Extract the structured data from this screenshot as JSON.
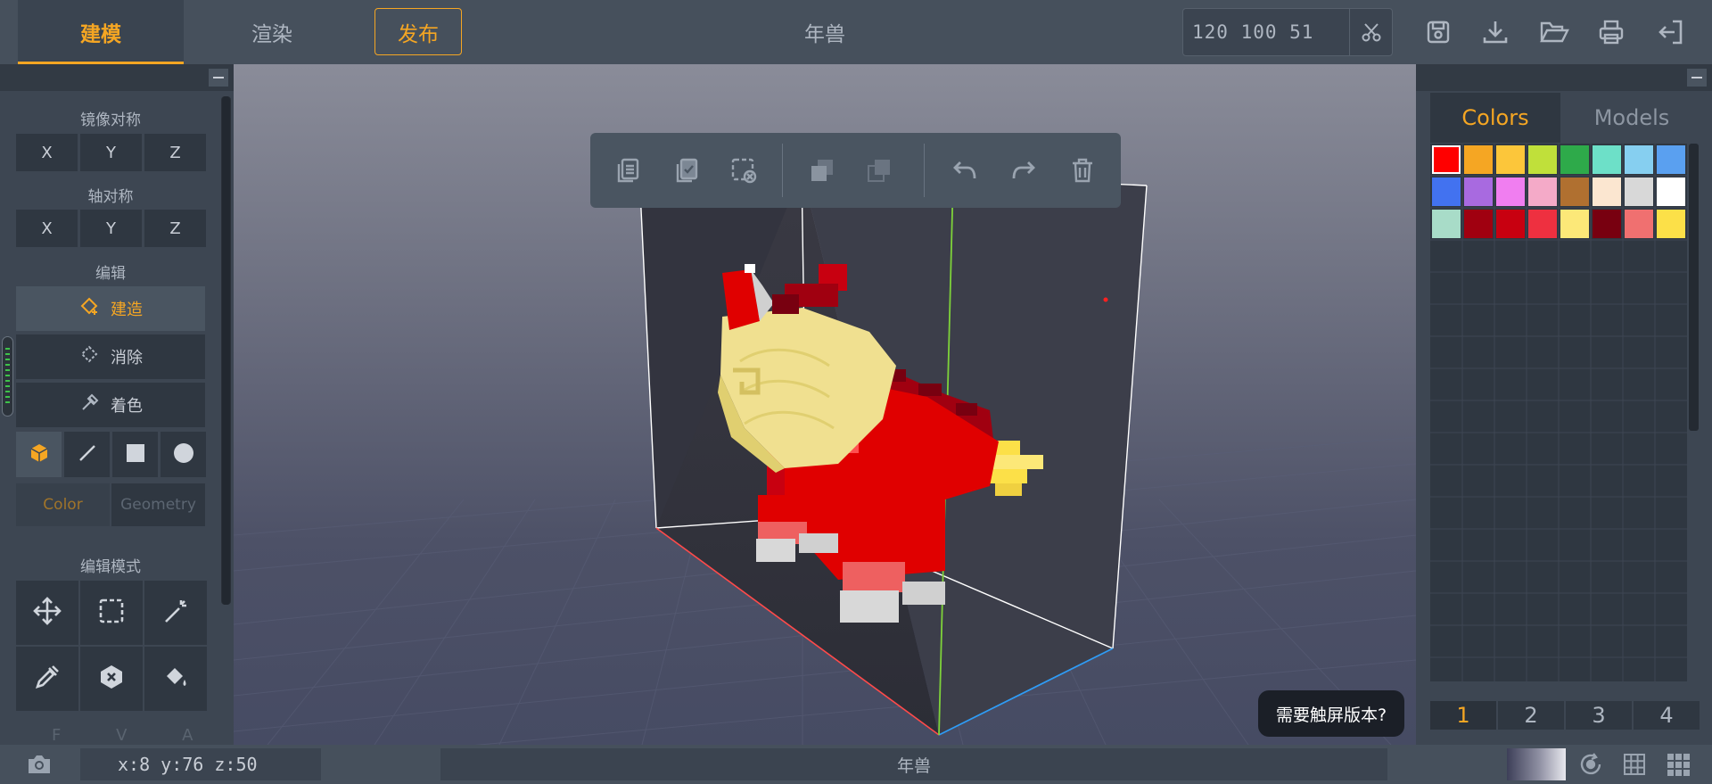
{
  "topbar": {
    "tabs": [
      {
        "label": "建模",
        "active": true
      },
      {
        "label": "渲染",
        "active": false
      }
    ],
    "publish_label": "发布",
    "doc_title": "年兽",
    "dimensions": "120 100 51",
    "icons": [
      "scissors-icon",
      "save-icon",
      "download-icon",
      "folder-open-icon",
      "print-icon",
      "exit-icon"
    ]
  },
  "left_panel": {
    "mirror_label": "镜像对称",
    "mirror_axes": [
      "X",
      "Y",
      "Z"
    ],
    "axis_label": "轴对称",
    "axis_axes": [
      "X",
      "Y",
      "Z"
    ],
    "edit_label": "编辑",
    "modes": [
      {
        "label": "建造",
        "icon": "build-icon",
        "active": true
      },
      {
        "label": "消除",
        "icon": "erase-icon",
        "active": false
      },
      {
        "label": "着色",
        "icon": "paint-icon",
        "active": false
      }
    ],
    "shapes": [
      "cube-icon",
      "line-icon",
      "square-icon",
      "circle-icon"
    ],
    "subtabs": [
      {
        "label": "Color",
        "active": true
      },
      {
        "label": "Geometry",
        "active": false
      }
    ],
    "edit_mode_label": "编辑模式",
    "tools": [
      "move-icon",
      "select-icon",
      "magic-wand-icon",
      "eyedropper-icon",
      "remove-icon",
      "bucket-fill-icon"
    ],
    "bottom_letters": "F V A"
  },
  "viewport": {
    "toolbar_icons": [
      "copy-icon",
      "paste-icon",
      "clear-selection-icon",
      "merge-icon",
      "subtract-icon",
      "undo-icon",
      "redo-icon",
      "delete-icon"
    ],
    "touch_tip": "需要触屏版本?"
  },
  "right_panel": {
    "tabs": [
      {
        "label": "Colors",
        "active": true
      },
      {
        "label": "Models",
        "active": false
      }
    ],
    "palette": [
      "#ff0000",
      "#f5a623",
      "#fcc63a",
      "#c0e03a",
      "#2eaa4a",
      "#6de0c8",
      "#86cff0",
      "#5aa0f0",
      "#4272f0",
      "#a86ae0",
      "#f07ef0",
      "#f4aac8",
      "#b07030",
      "#fbe6d0",
      "#d8d8d8",
      "#ffffff",
      "#a8dcc8",
      "#a00010",
      "#c80010",
      "#ee3040",
      "#fce878",
      "#780010",
      "#f07070",
      "#fce048"
    ],
    "selected_color": "#ff0000",
    "pages": [
      "1",
      "2",
      "3",
      "4"
    ],
    "active_page": "1"
  },
  "bottombar": {
    "coords": "x:8  y:76  z:50",
    "title": "年兽",
    "icons": [
      "camera-icon",
      "orbit-icon",
      "grid-icon",
      "palette-grid-icon"
    ]
  },
  "colors": {
    "accent": "#f5a623",
    "panel": "#3d4652",
    "button": "#2f3741",
    "axis_x": "#ff4040",
    "axis_y": "#7ed23a",
    "axis_z": "#2f9cf5"
  }
}
